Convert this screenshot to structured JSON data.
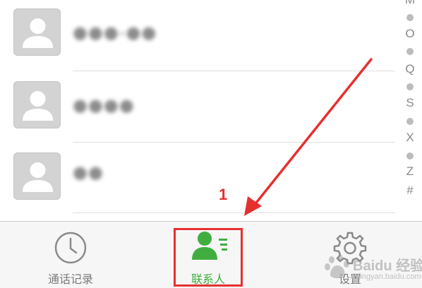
{
  "contacts": [
    {
      "name": "●●●-●●"
    },
    {
      "name": "●●●●"
    },
    {
      "name": "●●"
    }
  ],
  "alpha_index": [
    "M",
    "●",
    "O",
    "●",
    "Q",
    "●",
    "S",
    "●",
    "X",
    "●",
    "Z",
    "#"
  ],
  "tabs": {
    "calls_label": "通话记录",
    "contacts_label": "联系人",
    "settings_label": "设置",
    "active": "contacts"
  },
  "annotation": {
    "number": "1"
  },
  "watermark": {
    "text": "Baidu 经验",
    "sub": "jingyan.baidu.com"
  },
  "colors": {
    "accent_green": "#3fae3f",
    "annotation_red": "#e63030",
    "avatar_gray": "#d3d3d3"
  }
}
